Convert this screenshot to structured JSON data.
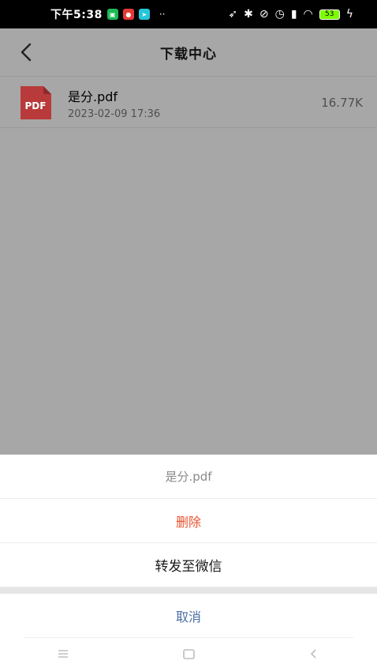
{
  "status_bar": {
    "time": "下午5:38",
    "battery": "53",
    "more_dots": "··"
  },
  "header": {
    "title": "下载中心"
  },
  "files": [
    {
      "icon_label": "PDF",
      "name": "是分.pdf",
      "date": "2023-02-09 17:36",
      "size": "16.77K"
    }
  ],
  "action_sheet": {
    "header": "是分.pdf",
    "delete_label": "删除",
    "forward_label": "转发至微信",
    "cancel_label": "取消"
  },
  "colors": {
    "pdf_red": "#d33b3b",
    "delete_red": "#e8532f",
    "cancel_blue": "#4a6fa5"
  }
}
